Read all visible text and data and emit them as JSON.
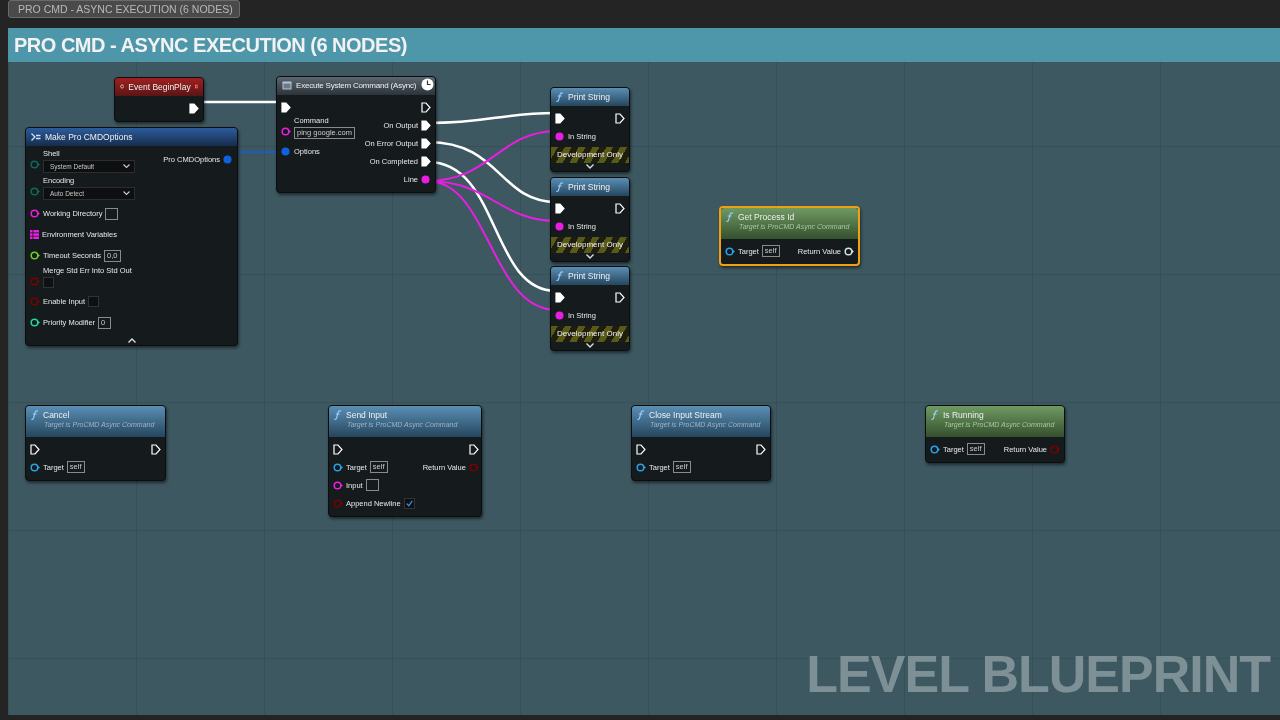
{
  "comment_tab": "PRO CMD - ASYNC EXECUTION (6 NODES)",
  "comment": {
    "title": "PRO CMD - ASYNC EXECUTION (6 NODES)"
  },
  "nodes": [
    {
      "title": "Event BeginPlay",
      "kind": "event",
      "selected": false,
      "outputs": [
        {
          "kind": "exec",
          "connected": true
        }
      ]
    },
    {
      "title": "Execute System Command (Async)",
      "kind": "async",
      "selected": false,
      "inputs": [
        {
          "kind": "exec",
          "connected": true
        },
        {
          "kind": "stacked",
          "label": "Command",
          "color": "#e81ee0",
          "connected": false,
          "value": "ping google.com"
        },
        {
          "kind": "data",
          "label": "Options",
          "color": "#1060e0",
          "connected": true
        }
      ],
      "outputs": [
        {
          "kind": "exec",
          "connected": false
        },
        {
          "kind": "exec",
          "label": "On Output",
          "connected": true
        },
        {
          "kind": "exec",
          "label": "On Error Output",
          "connected": true
        },
        {
          "kind": "exec",
          "label": "On Completed",
          "connected": true
        },
        {
          "kind": "data",
          "label": "Line",
          "color": "#e81ee0",
          "connected": true
        }
      ]
    },
    {
      "title": "Make Pro CMDOptions",
      "kind": "struct",
      "selected": false,
      "advanced_expanded": true,
      "inputs": [
        {
          "kind": "dropdown",
          "label": "Shell",
          "color": "#0a6a5c",
          "connected": false,
          "value": "System Default"
        },
        {
          "kind": "dropdown",
          "label": "Encoding",
          "color": "#0a6a5c",
          "connected": false,
          "value": "Auto Detect"
        },
        {
          "kind": "data",
          "label": "Working Directory",
          "color": "#e81ee0",
          "connected": false,
          "empty_field": true
        },
        {
          "kind": "array",
          "label": "Environment Variables",
          "color": "#e81ee0"
        },
        {
          "kind": "data",
          "label": "Timeout Seconds",
          "color": "#6ad01e",
          "connected": false,
          "value": "0,0"
        },
        {
          "kind": "stacked",
          "label": "Merge Std Err Into Std Out",
          "color": "#7a0000",
          "connected": false,
          "checked": false
        },
        {
          "kind": "data",
          "label": "Enable Input",
          "color": "#7a0000",
          "connected": false,
          "checked": false
        },
        {
          "kind": "data",
          "label": "Priority Modifier",
          "color": "#22d6a0",
          "connected": false,
          "value": "0"
        }
      ],
      "outputs": [
        {
          "kind": "data",
          "label": "Pro CMDOptions",
          "color": "#1060e0",
          "connected": true
        }
      ]
    },
    {
      "title": "Print String",
      "kind": "function",
      "selected": false,
      "footer": "Development Only",
      "advanced_expanded": false,
      "inputs": [
        {
          "kind": "exec",
          "connected": true
        },
        {
          "kind": "data",
          "label": "In String",
          "color": "#e81ee0",
          "connected": true
        }
      ],
      "outputs": [
        {
          "kind": "exec",
          "connected": false
        }
      ]
    },
    {
      "title": "Print String",
      "kind": "function",
      "selected": false,
      "footer": "Development Only",
      "advanced_expanded": false,
      "inputs": [
        {
          "kind": "exec",
          "connected": true
        },
        {
          "kind": "data",
          "label": "In String",
          "color": "#e81ee0",
          "connected": true
        }
      ],
      "outputs": [
        {
          "kind": "exec",
          "connected": false
        }
      ]
    },
    {
      "title": "Print String",
      "kind": "function",
      "selected": false,
      "footer": "Development Only",
      "advanced_expanded": false,
      "inputs": [
        {
          "kind": "exec",
          "connected": true
        },
        {
          "kind": "data",
          "label": "In String",
          "color": "#e81ee0",
          "connected": true
        }
      ],
      "outputs": [
        {
          "kind": "exec",
          "connected": false
        }
      ]
    },
    {
      "title": "Get Process Id",
      "subtitle": "Target is ProCMD Async Command",
      "kind": "pure",
      "selected": true,
      "inputs": [
        {
          "kind": "data",
          "label": "Target",
          "color": "#2aa0e6",
          "connected": false,
          "value": "self"
        }
      ],
      "outputs": [
        {
          "kind": "data",
          "label": "Return Value",
          "color": "#d0e4dc",
          "connected": false
        }
      ]
    },
    {
      "title": "Cancel",
      "subtitle": "Target is ProCMD Async Command",
      "kind": "function",
      "selected": false,
      "inputs": [
        {
          "kind": "exec",
          "connected": false
        },
        {
          "kind": "data",
          "label": "Target",
          "color": "#2aa0e6",
          "connected": false,
          "value": "self"
        }
      ],
      "outputs": [
        {
          "kind": "exec",
          "connected": false
        }
      ]
    },
    {
      "title": "Send Input",
      "subtitle": "Target is ProCMD Async Command",
      "kind": "function",
      "selected": false,
      "inputs": [
        {
          "kind": "exec",
          "connected": false
        },
        {
          "kind": "data",
          "label": "Target",
          "color": "#2aa0e6",
          "connected": false,
          "value": "self"
        },
        {
          "kind": "data",
          "label": "Input",
          "color": "#e81ee0",
          "connected": false,
          "empty_field": true
        },
        {
          "kind": "data",
          "label": "Append Newline",
          "color": "#7a0000",
          "connected": false,
          "checked": true
        }
      ],
      "outputs": [
        {
          "kind": "exec",
          "connected": false
        },
        {
          "kind": "data",
          "label": "Return Value",
          "color": "#7a0000",
          "connected": false
        }
      ]
    },
    {
      "title": "Close Input Stream",
      "subtitle": "Target is ProCMD Async Command",
      "kind": "function",
      "selected": false,
      "inputs": [
        {
          "kind": "exec",
          "connected": false
        },
        {
          "kind": "data",
          "label": "Target",
          "color": "#2aa0e6",
          "connected": false,
          "value": "self"
        }
      ],
      "outputs": [
        {
          "kind": "exec",
          "connected": false
        }
      ]
    },
    {
      "title": "Is Running",
      "subtitle": "Target is ProCMD Async Command",
      "kind": "pure",
      "selected": false,
      "inputs": [
        {
          "kind": "data",
          "label": "Target",
          "color": "#2aa0e6",
          "connected": false,
          "value": "self"
        }
      ],
      "outputs": [
        {
          "kind": "data",
          "label": "Return Value",
          "color": "#7a0000",
          "connected": false
        }
      ]
    }
  ],
  "watermark": "LEVEL BLUEPRINT"
}
